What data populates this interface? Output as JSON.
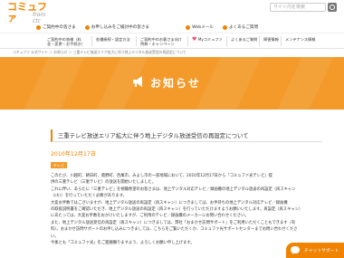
{
  "header": {
    "logo": "コミュファ",
    "logo_sub": "from ctc",
    "search_placeholder": "サイト内を検索",
    "topnav": [
      "ご契約中の皆さま",
      "お申し込みをご検討中の皆さま",
      "Webメール",
      "よくあるご質問"
    ]
  },
  "subnav": {
    "items": [
      "ご契約中の皆様（料金・変更・お手続き）",
      "各種接続・設定方法",
      "ご契約中のお客さま向け特典・キャンペーン",
      "Myコミュファ",
      "よくあるご質問",
      "障害情報",
      "メンテナンス情報"
    ]
  },
  "breadcrumb": "コミュファ 公式サイト ＞ お知らせ ＞ 三重テレビ放送エリア拡大に伴う地上デジタル放送受信の再設定について",
  "banner": {
    "title": "お知らせ"
  },
  "article": {
    "title": "三重テレビ放送エリア拡大に伴う地上デジタル放送受信の再設定について",
    "date": "2010年12月17日",
    "badge": "テレビ",
    "paragraphs": [
      "このたび、川越町、朝日町、菰野町、西尾市、みよし市の一部地域において、2010年12月17日から「コミュファ光テレビ」提",
      "供の三重テレビ（三重テレビ）の放送を開始いたしました。",
      "これに伴い、あらたに「三重テレビ」を視聴希望のお客さまは、地上デジタル対応テレビ／録画機の地上デジタル放送の再設定（再スキャン",
      "（ch））を行っていただく必要があります。",
      "大変お手数ではございますが、地上デジタル放送の再設定（再スキャン）につきましては、お手持ちの地上デジタル対応テレビ／録画機",
      "の取扱説明書をご確認いただき、地上デジタル放送の再設定（再スキャン）を行っていただけますようお願いいたします。再設定（再スキャン）",
      "にあたっては、大変お手数をおかけいたしますが、ご利用のテレビ／録画機のメーカーにお問い合わせください。",
      "また、地上デジタル放送受信の再設定（再スキャン）につきましては、弊社「おまかせ訪問サポート」をご利用いただくこともできます（有",
      "料）。おまかせ訪問サポートのお申し込みにつきましては、こちらをご覧いただくか、コミュファ光サポートセンターまでお問い合わせくださ",
      "い。",
      "今後とも「コミュファ光」をご愛顧賜りますよう、よろしくお願い申し上げます。"
    ]
  },
  "chat": {
    "label": "チャットサポート"
  },
  "colors": {
    "accent": "#f08300",
    "banner": "#f39a2a"
  }
}
